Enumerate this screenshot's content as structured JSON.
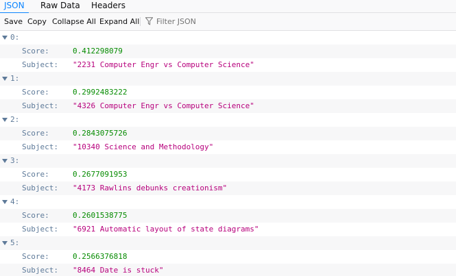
{
  "tabs": [
    {
      "label": "JSON",
      "selected": true
    },
    {
      "label": "Raw Data",
      "selected": false
    },
    {
      "label": "Headers",
      "selected": false
    }
  ],
  "toolbar": {
    "save": "Save",
    "copy": "Copy",
    "collapse_all": "Collapse All",
    "expand_all": "Expand All",
    "filter_placeholder": "Filter JSON",
    "filter_value": ""
  },
  "colors": {
    "accent": "#0a84ff",
    "key": "#5e7a99",
    "number": "#058b00",
    "string": "#b7007c"
  },
  "icons": {
    "filter": "funnel-icon",
    "expander": "chevron-down-icon"
  },
  "json": {
    "key_score": "Score:",
    "key_subject": "Subject:",
    "items": [
      {
        "index": "0:",
        "score": "0.412298079",
        "subject": "\"2231 Computer Engr vs Computer Science\""
      },
      {
        "index": "1:",
        "score": "0.2992483222",
        "subject": "\"4326 Computer Engr vs Computer Science\""
      },
      {
        "index": "2:",
        "score": "0.2843075726",
        "subject": "\"10340 Science and Methodology\""
      },
      {
        "index": "3:",
        "score": "0.2677091953",
        "subject": "\"4173 Rawlins debunks creationism\""
      },
      {
        "index": "4:",
        "score": "0.2601538775",
        "subject": "\"6921 Automatic layout of state diagrams\""
      },
      {
        "index": "5:",
        "score": "0.2566376818",
        "subject": "\"8464 Date is stuck\""
      }
    ]
  }
}
